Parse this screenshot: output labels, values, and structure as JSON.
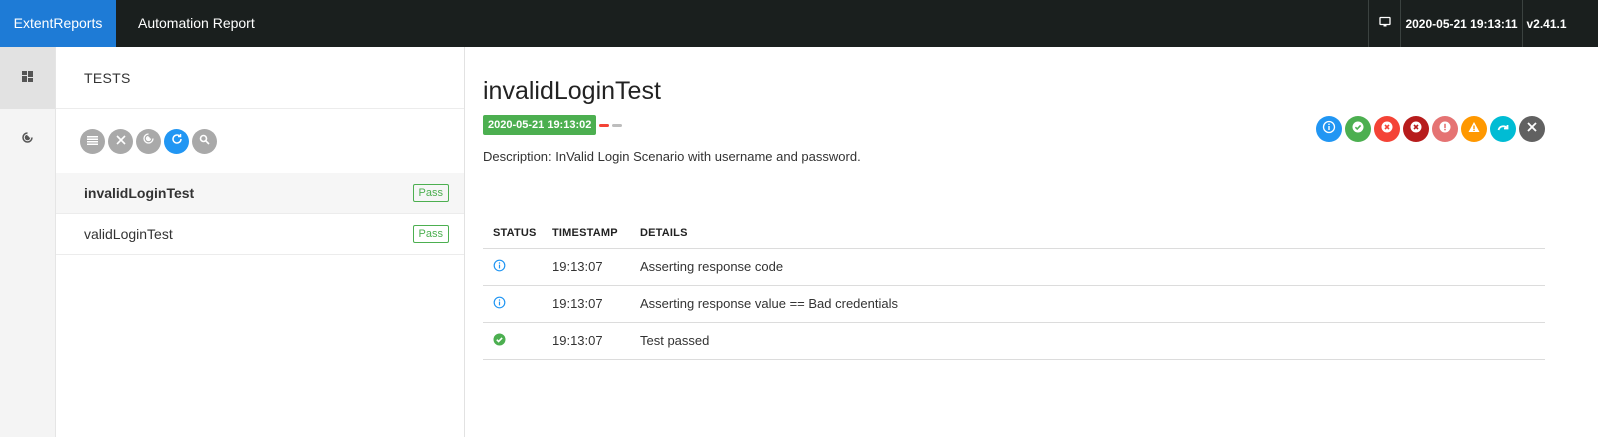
{
  "topbar": {
    "brand": "ExtentReports",
    "report_name": "Automation Report",
    "icons": [
      "monitor-icon"
    ],
    "date": "2020-05-21 19:13:11",
    "version": "v2.41.1"
  },
  "leftnav": {
    "items": [
      {
        "icon": "dashboard-grid-icon",
        "active": true
      },
      {
        "icon": "radar-icon",
        "active": false
      }
    ]
  },
  "tests_panel": {
    "title": "TESTS",
    "toolbar_icons": [
      "list-icon",
      "clear-icon",
      "radar-filter-icon",
      "refresh-icon",
      "search-icon"
    ],
    "tests": [
      {
        "name": "invalidLoginTest",
        "status": "Pass",
        "active": true
      },
      {
        "name": "validLoginTest",
        "status": "Pass",
        "active": false
      }
    ]
  },
  "detail": {
    "title": "invalidLoginTest",
    "timestamp": "2020-05-21 19:13:02",
    "description": "Description: InValid Login Scenario with username and password.",
    "status_filters": [
      {
        "icon": "info-icon",
        "color": "#2196f3"
      },
      {
        "icon": "pass-icon",
        "color": "#4caf50"
      },
      {
        "icon": "fail-icon",
        "color": "#f44336"
      },
      {
        "icon": "fatal-icon",
        "color": "#b71c1c"
      },
      {
        "icon": "error-icon",
        "color": "#e57373"
      },
      {
        "icon": "warning-icon",
        "color": "#ff9800"
      },
      {
        "icon": "skip-icon",
        "color": "#00bcd4"
      },
      {
        "icon": "clear-icon",
        "color": "#616161"
      }
    ],
    "log": {
      "headers": {
        "status": "STATUS",
        "timestamp": "TIMESTAMP",
        "details": "DETAILS"
      },
      "rows": [
        {
          "status": "info",
          "timestamp": "19:13:07",
          "details": "Asserting response code"
        },
        {
          "status": "info",
          "timestamp": "19:13:07",
          "details": "Asserting response value == Bad credentials"
        },
        {
          "status": "pass",
          "timestamp": "19:13:07",
          "details": "Test passed"
        }
      ]
    }
  },
  "colors": {
    "brand": "#1e7bd6",
    "topbar": "#1a1f1e",
    "pass": "#4caf50",
    "info": "#2196f3"
  }
}
